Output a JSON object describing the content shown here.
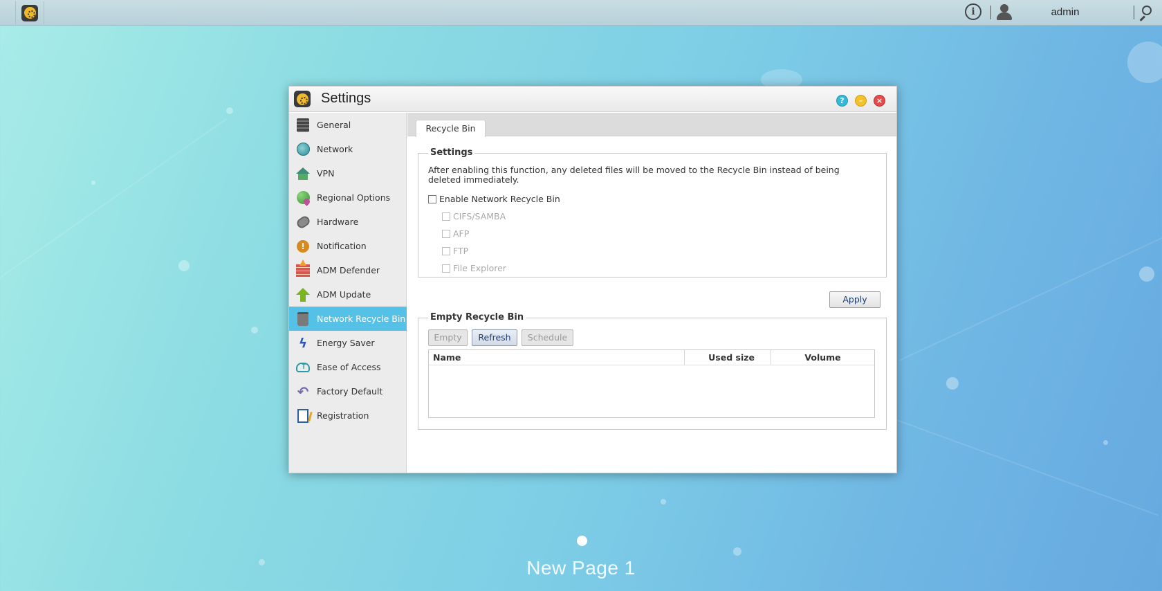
{
  "taskbar": {
    "app_icon": "settings-wheel-icon",
    "info_icon": "info-icon",
    "user_icon": "user-icon",
    "username": "admin",
    "search_icon": "search-icon"
  },
  "window": {
    "title": "Settings",
    "buttons": {
      "help": "help-icon",
      "minimize": "minimize-icon",
      "close": "close-icon"
    }
  },
  "sidebar": {
    "items": [
      {
        "label": "General",
        "icon": "nas-icon"
      },
      {
        "label": "Network",
        "icon": "globe-icon"
      },
      {
        "label": "VPN",
        "icon": "house-network-icon"
      },
      {
        "label": "Regional Options",
        "icon": "globe-pin-icon"
      },
      {
        "label": "Hardware",
        "icon": "hardware-icon"
      },
      {
        "label": "Notification",
        "icon": "alert-icon"
      },
      {
        "label": "ADM Defender",
        "icon": "firewall-icon"
      },
      {
        "label": "ADM Update",
        "icon": "upload-arrow-icon"
      },
      {
        "label": "Network Recycle Bin",
        "icon": "trash-icon",
        "active": true
      },
      {
        "label": "Energy Saver",
        "icon": "lightning-icon"
      },
      {
        "label": "Ease of Access",
        "icon": "cloud-upload-icon"
      },
      {
        "label": "Factory Default",
        "icon": "undo-icon"
      },
      {
        "label": "Registration",
        "icon": "clipboard-icon"
      }
    ]
  },
  "tabs": [
    {
      "label": "Recycle Bin",
      "active": true
    }
  ],
  "settings": {
    "legend": "Settings",
    "description": "After enabling this function, any deleted files will be moved to the Recycle Bin instead of being deleted immediately.",
    "enable_label": "Enable Network Recycle Bin",
    "enable_checked": false,
    "protocols": [
      {
        "label": "CIFS/SAMBA",
        "checked": false,
        "disabled": true
      },
      {
        "label": "AFP",
        "checked": false,
        "disabled": true
      },
      {
        "label": "FTP",
        "checked": false,
        "disabled": true
      },
      {
        "label": "File Explorer",
        "checked": false,
        "disabled": true
      }
    ],
    "apply_label": "Apply"
  },
  "empty_bin": {
    "legend": "Empty Recycle Bin",
    "buttons": {
      "empty": "Empty",
      "refresh": "Refresh",
      "schedule": "Schedule"
    },
    "columns": [
      "Name",
      "Used size",
      "Volume"
    ],
    "rows": []
  },
  "desktop": {
    "page_label": "New Page 1"
  }
}
